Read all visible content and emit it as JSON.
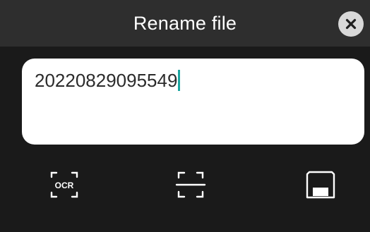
{
  "dialog": {
    "title": "Rename file",
    "close_icon": "close-icon"
  },
  "filename": {
    "value": "20220829095549"
  },
  "toolbar": {
    "ocr_icon": "ocr-scan-icon",
    "ocr_label": "OCR",
    "scan_icon": "scan-frame-icon",
    "save_icon": "save-disk-icon"
  },
  "colors": {
    "background": "#1a1a1a",
    "header": "#2e2e2e",
    "caret": "#1ba5a0",
    "close_button": "#d8d8d8"
  }
}
